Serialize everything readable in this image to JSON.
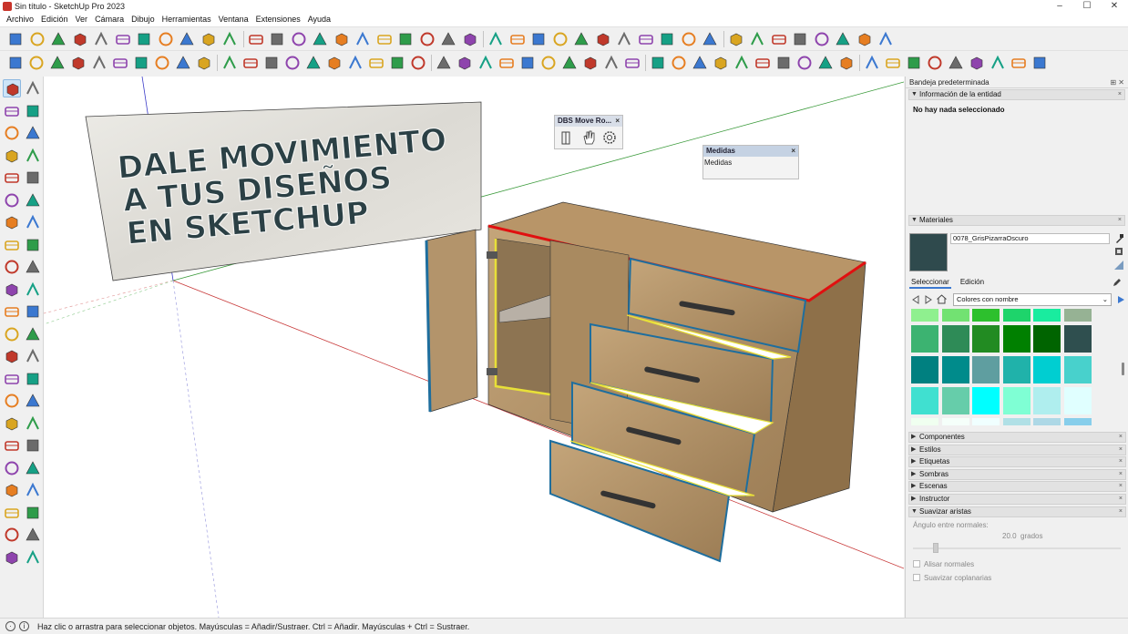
{
  "app": {
    "title": "Sin título - SketchUp Pro 2023",
    "window_controls": [
      "–",
      "☐",
      "✕"
    ]
  },
  "menu": [
    "Archivo",
    "Edición",
    "Ver",
    "Cámara",
    "Dibujo",
    "Herramientas",
    "Ventana",
    "Extensiones",
    "Ayuda"
  ],
  "toolbar_icons_row1": [
    "new-file-icon",
    "open-file-icon",
    "save-icon",
    "cut-icon",
    "copy-icon",
    "paste-icon",
    "erase-icon",
    "undo-icon",
    "redo-icon",
    "print-icon",
    "model-info-icon",
    "ocl-icon",
    "lines-icon",
    "axes-icon",
    "iso-view-icon",
    "top-view-icon",
    "front-view-icon",
    "right-view-icon",
    "back-view-icon",
    "left-view-icon",
    "bottom-view-icon",
    "component-gold-icon",
    "component-blue-icon",
    "component-green-icon",
    "warehouse-icon",
    "extension-icon",
    "home-icon",
    "house-icon",
    "roof-icon",
    "box-icon",
    "square-icon",
    "mirror-icon",
    "f6-icon",
    "purple-cube-icon",
    "layer-icon",
    "layers-stack-icon",
    "tags-icon",
    "move-axis-icon",
    "blue-cube-icon",
    "view-cube-icon",
    "iso-cube-icon"
  ],
  "toolbar_icons_row2": [
    "grid-icon",
    "funnel-icon",
    "circle-tool-icon",
    "protractor-icon",
    "tape-icon",
    "star-icon",
    "dome-icon",
    "disc-icon",
    "vray-icon",
    "globe-icon",
    "teapot-icon",
    "teapot-settings-icon",
    "sphere-icon",
    "refresh-icon",
    "sun-icon",
    "render-region-icon",
    "frame-icon",
    "window-icon",
    "window2-icon",
    "lock-icon",
    "stack-icon",
    "grid-stack-icon",
    "scale-icon",
    "cube-wire-icon",
    "cube-hidden-icon",
    "sphere-wire-icon",
    "sphere-shaded-icon",
    "select-tool-icon",
    "green-cube-icon",
    "yellow-cube-icon",
    "red-arrow-icon",
    "blue-arrows-icon",
    "red-arrows-icon",
    "diagonal-icon",
    "cyan-shape-icon",
    "blue-hook-icon",
    "red-hook-icon",
    "flag-icon",
    "orange-arrow-icon",
    "refresh-gray-icon",
    "pinwheel-icon",
    "plus-circle-icon",
    "green-house-icon",
    "stripe-icon",
    "checker-icon",
    "cloud-icon",
    "gear-icon",
    "mail-icon",
    "info-icon"
  ],
  "left_tools": [
    "select-tool-icon",
    "orbit-tool-icon",
    "paint-bucket-icon",
    "eraser-icon",
    "cube-component-icon",
    "tape-measure-icon",
    "pencil-icon",
    "freehand-icon",
    "rectangle-icon",
    "rotated-rectangle-icon",
    "circle-icon",
    "polygon-icon",
    "arc-icon",
    "arc-2pt-icon",
    "arc-3pt-icon",
    "pie-icon",
    "move-icon",
    "push-pull-icon",
    "rotate-icon",
    "follow-me-icon",
    "scale-icon",
    "offset-icon",
    "flip-icon",
    "mirror-icon",
    "tape-tool-icon",
    "text-icon",
    "protractor-tool-icon",
    "3d-text-icon",
    "axes-tool-icon",
    "dimension-icon",
    "orbit-icon",
    "pan-icon",
    "zoom-icon",
    "zoom-window-icon",
    "zoom-extents-icon",
    "previous-view-icon",
    "position-camera-icon",
    "walk-icon",
    "look-around-icon",
    "section-plane-icon",
    "sandbox-icon",
    "sandbox-from-scratch-icon",
    "sandbox-contours-icon",
    "sandbox-smoove-icon"
  ],
  "viewport": {
    "sign_lines": [
      "DALE MOVIMIENTO",
      "A TUS DISEÑOS",
      "EN SKETCHUP"
    ],
    "dbs_toolbar": {
      "title": "DBS Move Ro...",
      "close": "×",
      "icons": [
        "door-icon",
        "hand-icon",
        "gear-icon"
      ]
    },
    "measure_toolbar": {
      "title": "Medidas",
      "close": "×",
      "label": "Medidas"
    }
  },
  "tray": {
    "title": "Bandeja predeterminada",
    "title_buttons": "⊞ ✕",
    "entity_info": {
      "header": "Información de la entidad",
      "message": "No hay nada seleccionado"
    },
    "materials": {
      "header": "Materiales",
      "material_name": "0078_GrisPizarraOscuro",
      "preview_color": "#2f4a4d",
      "tabs": [
        "Seleccionar",
        "Edición"
      ],
      "collection": "Colores con nombre",
      "swatch_rows": [
        [
          "#8ff08f",
          "#72e272",
          "#2dc02d",
          "#1ed46b",
          "#19ec9f",
          "#96b294"
        ],
        [
          "#3cb371",
          "#2e8b57",
          "#228b22",
          "#008000",
          "#006400",
          "#2f4f4f"
        ],
        [
          "#008080",
          "#008b8b",
          "#5f9ea0",
          "#20b2aa",
          "#00ced1",
          "#48d1cc"
        ],
        [
          "#40e0d0",
          "#66cdaa",
          "#00ffff",
          "#7fffd4",
          "#afeeee",
          "#e0ffff"
        ],
        [
          "#f0fff0",
          "#f5fffa",
          "#f0ffff",
          "#b0e0e6",
          "#add8e6",
          "#87ceeb"
        ]
      ]
    },
    "collapsed": [
      "Componentes",
      "Estilos",
      "Etiquetas",
      "Sombras",
      "Escenas",
      "Instructor"
    ],
    "smooth": {
      "header": "Suavizar aristas",
      "angle_label": "Ángulo entre normales:",
      "angle_value": "20.0",
      "angle_unit": "grados",
      "angle_fraction": 0.11,
      "checkbox1": "Alisar normales",
      "checkbox2": "Suavizar coplanarias"
    }
  },
  "status": {
    "text": "Haz clic o arrastra para seleccionar objetos. Mayúsculas = Añadir/Sustraer. Ctrl = Añadir. Mayúsculas + Ctrl = Sustraer.",
    "icons": [
      "location-icon",
      "info-icon"
    ]
  },
  "colors": {
    "accent": "#3b78d0",
    "wood": "#a88b63",
    "edge_red": "#e01010",
    "edge_blue": "#1e6e9e",
    "edge_yellow": "#e8e038",
    "sign_text": "#2b4045"
  }
}
